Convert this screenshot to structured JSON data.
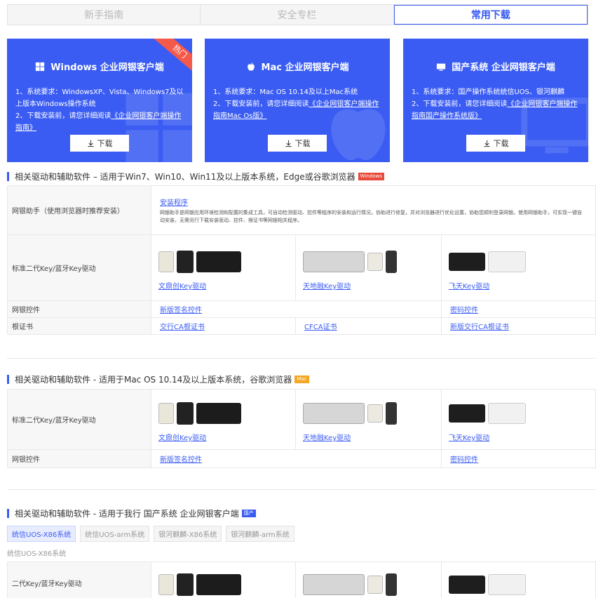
{
  "tabs": [
    "新手指南",
    "安全专栏",
    "常用下载"
  ],
  "cards": [
    {
      "title": "Windows 企业网银客户端",
      "ribbon": "热门",
      "line1": "1、系统要求：WindowsXP、Vista、Windows7及以上版本Windows操作系统",
      "line2_prefix": "2、下载安装前，请您详细阅读",
      "line2_link": "《企业网银客户端操作指南》",
      "button": "下载",
      "icon": "windows-icon"
    },
    {
      "title": "Mac 企业网银客户端",
      "line1": "1、系统要求：Mac OS 10.14及以上Mac系统",
      "line2_prefix": "2、下载安装前，请您详细阅读",
      "line2_link": "《企业网银客户端操作指南Mac Os版》",
      "button": "下载",
      "icon": "apple-icon"
    },
    {
      "title": "国产系统 企业网银客户端",
      "line1": "1、系统要求：国产操作系统统信UOS、银河麒麟",
      "line2_prefix": "2、下载安装前，请您详细阅读",
      "line2_link": "《企业网银客户端操作指南国产操作系统版》",
      "button": "下载",
      "icon": "monitor-icon"
    }
  ],
  "section1": {
    "title": "相关驱动和辅助软件 – 适用于Win7、Win10、Win11及以上版本系统，Edge或谷歌浏览器",
    "badge": "Windows",
    "badge_color": "#e84a3b",
    "helper_label": "网银助手（使用浏览器时推荐安装）",
    "helper_link": "安装程序",
    "helper_desc": "网银助手是网银应用环境检测和配置的集成工具，可自动检测驱动、控件等程序的安装和运行情况，协助进行修复，并对浏览器进行优化设置，协助您顺利登录网银。使用网银助手，可实现一键自动安装，无需另行下载安装驱动、控件、根证书等网银相关程序。",
    "key_label": "标准二代Key/蓝牙Key驱动",
    "key_links": [
      "文鼎创Key驱动",
      "天地融Key驱动",
      "飞天Key驱动"
    ],
    "control_label": "网银控件",
    "control_links": [
      "新版签名控件",
      "密码控件"
    ],
    "cert_label": "根证书",
    "cert_links": [
      "交行CA根证书",
      "CFCA证书",
      "新版交行CA根证书"
    ]
  },
  "section2": {
    "title": "相关驱动和辅助软件 - 适用于Mac OS 10.14及以上版本系统，谷歌浏览器",
    "badge": "Mac",
    "badge_color": "#f5a623",
    "key_label": "标准二代Key/蓝牙Key驱动",
    "key_links": [
      "文鼎创Key驱动",
      "天地融Key驱动",
      "飞天Key驱动"
    ],
    "control_label": "网银控件",
    "control_links": [
      "新版签名控件",
      "密码控件"
    ]
  },
  "section3": {
    "title": "相关驱动和辅助软件 - 适用于我行 国产系统 企业网银客户端",
    "badge": "国产",
    "badge_color": "#3a5cf3",
    "os_tabs": [
      "统信UOS-X86系统",
      "统信UOS-arm系统",
      "银河麒麟-X86系统",
      "银河麒麟-arm系统"
    ],
    "os_sub": "统信UOS-X86系统",
    "key_label": "二代Key/蓝牙Key驱动"
  }
}
